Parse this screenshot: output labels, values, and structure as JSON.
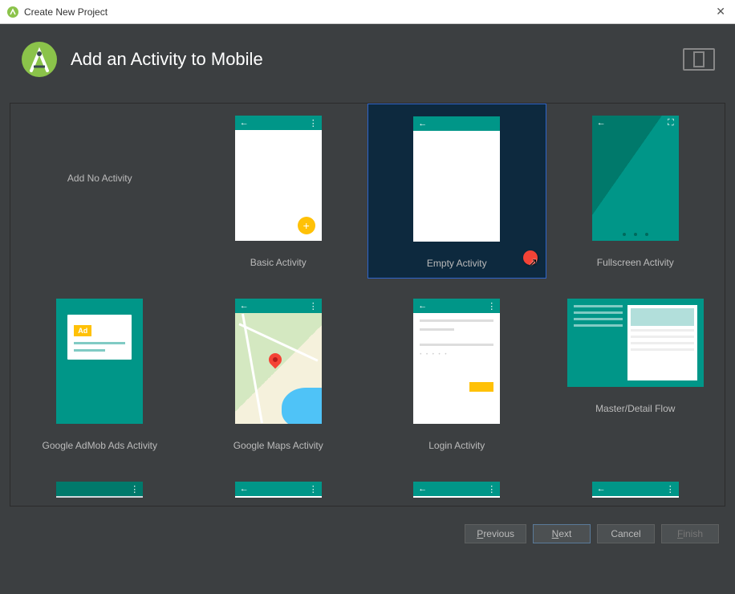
{
  "titlebar": {
    "title": "Create New Project"
  },
  "header": {
    "title": "Add an Activity to Mobile"
  },
  "cells": [
    {
      "label": "Add No Activity"
    },
    {
      "label": "Basic Activity"
    },
    {
      "label": "Empty Activity"
    },
    {
      "label": "Fullscreen Activity"
    },
    {
      "label": "Google AdMob Ads Activity"
    },
    {
      "label": "Google Maps Activity"
    },
    {
      "label": "Login Activity"
    },
    {
      "label": "Master/Detail Flow"
    }
  ],
  "ad_label": "Ad",
  "footer": {
    "previous_key": "P",
    "previous_rest": "revious",
    "next_key": "N",
    "next_rest": "ext",
    "cancel": "Cancel",
    "finish_key": "F",
    "finish_rest": "inish"
  }
}
